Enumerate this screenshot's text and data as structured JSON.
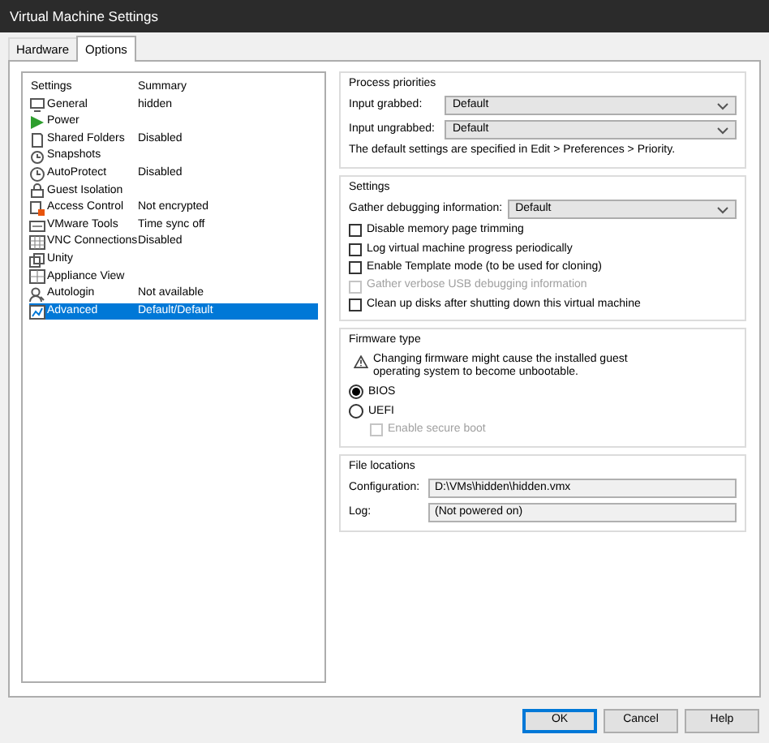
{
  "window": {
    "title": "Virtual Machine Settings"
  },
  "tabs": [
    {
      "label": "Hardware",
      "selected": false
    },
    {
      "label": "Options",
      "selected": true
    }
  ],
  "settings_list": {
    "columns": [
      "Settings",
      "Summary"
    ],
    "items": [
      {
        "name": "General",
        "summary": "hidden",
        "selected": false
      },
      {
        "name": "Power",
        "selected": false
      },
      {
        "name": "Shared Folders",
        "summary": "Disabled",
        "selected": false
      },
      {
        "name": "Snapshots",
        "selected": false
      },
      {
        "name": "AutoProtect",
        "summary": "Disabled",
        "selected": false
      },
      {
        "name": "Guest Isolation",
        "selected": false
      },
      {
        "name": "Access Control",
        "summary": "Not encrypted",
        "selected": false
      },
      {
        "name": "VMware Tools",
        "summary": "Time sync off",
        "selected": false
      },
      {
        "name": "VNC Connections",
        "summary": "Disabled",
        "selected": false
      },
      {
        "name": "Unity",
        "selected": false
      },
      {
        "name": "Appliance View",
        "selected": false
      },
      {
        "name": "Autologin",
        "summary": "Not available",
        "selected": false
      },
      {
        "name": "Advanced",
        "summary": "Default/Default",
        "selected": true
      }
    ]
  },
  "process_priorities": {
    "title": "Process priorities",
    "fields": [
      {
        "label": "Input grabbed:",
        "value": "Default"
      },
      {
        "label": "Input ungrabbed:",
        "value": "Default"
      }
    ],
    "note": "The default settings are specified in Edit > Preferences > Priority."
  },
  "settings": {
    "title": "Settings",
    "debug_field": {
      "label": "Gather debugging information:",
      "value": "Default"
    },
    "options": [
      {
        "label": "Disable memory page trimming",
        "checked": false,
        "disabled": false
      },
      {
        "label": "Log virtual machine progress periodically",
        "checked": false,
        "disabled": false
      },
      {
        "label": "Enable Template mode (to be used for cloning)",
        "checked": false,
        "disabled": false
      },
      {
        "label": "Gather verbose USB debugging information",
        "checked": false,
        "disabled": true
      },
      {
        "label": "Clean up disks after shutting down this virtual machine",
        "checked": false,
        "disabled": false
      }
    ]
  },
  "firmware": {
    "title": "Firmware type",
    "warning": "Changing firmware might cause the installed guest operating system to become unbootable.",
    "options": [
      {
        "label": "BIOS",
        "selected": true
      },
      {
        "label": "UEFI",
        "selected": false
      }
    ],
    "secure_boot": {
      "label": "Enable secure boot",
      "checked": false,
      "disabled": true
    }
  },
  "file_locations": {
    "title": "File locations",
    "fields": [
      {
        "label": "Configuration:",
        "value": "D:\\VMs\\hidden\\hidden.vmx"
      },
      {
        "label": "Log:",
        "value": "(Not powered on)"
      }
    ]
  },
  "buttons": [
    {
      "label": "OK",
      "default": true
    },
    {
      "label": "Cancel",
      "default": false
    },
    {
      "label": "Help",
      "default": false
    }
  ]
}
